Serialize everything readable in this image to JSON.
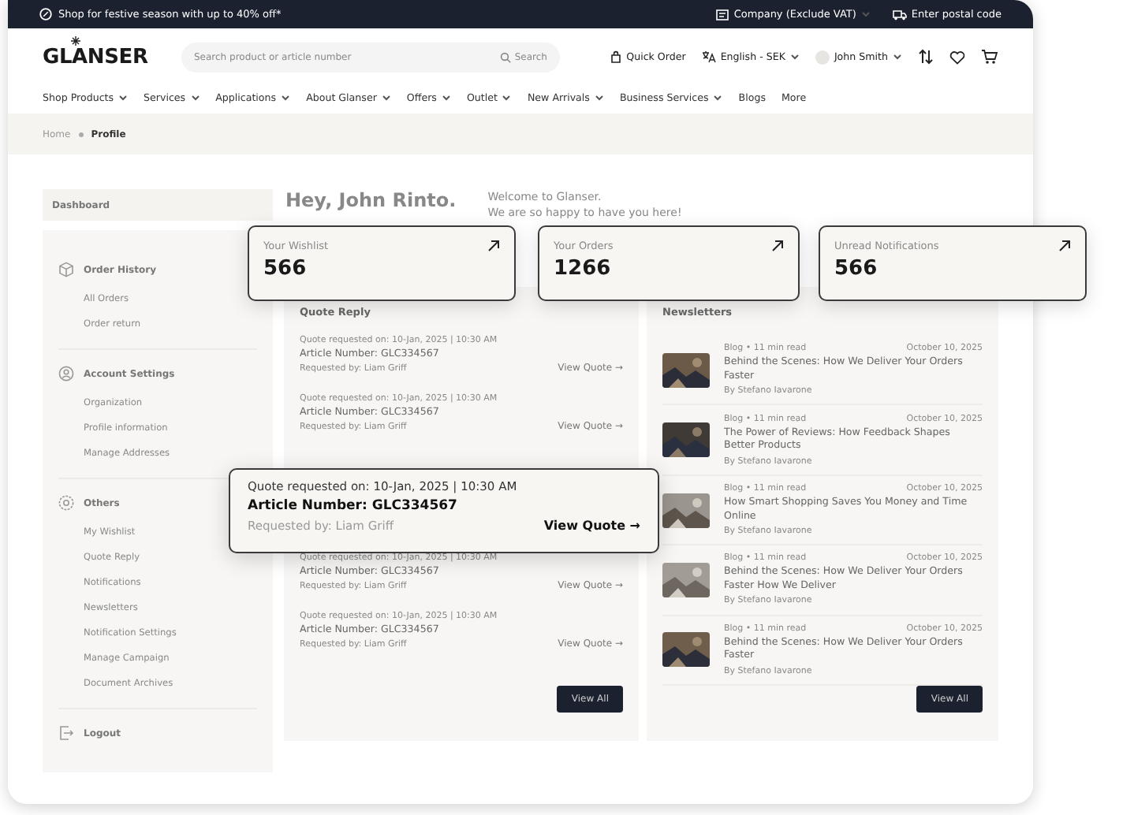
{
  "promo_bar": {
    "message": "Shop for festive season with up to 40% off*",
    "account_type": "Company (Exclude VAT)",
    "postal_code": "Enter postal code"
  },
  "header": {
    "logo": "GLANSER",
    "search": {
      "placeholder": "Search product or article number",
      "button": "Search"
    },
    "quick_order": "Quick Order",
    "language": "English - SEK",
    "user": "John Smith"
  },
  "nav": [
    {
      "label": "Shop Products",
      "has_menu": true
    },
    {
      "label": "Services",
      "has_menu": true
    },
    {
      "label": "Applications",
      "has_menu": true
    },
    {
      "label": "About Glanser",
      "has_menu": true
    },
    {
      "label": "Offers",
      "has_menu": true
    },
    {
      "label": "Outlet",
      "has_menu": true
    },
    {
      "label": "New Arrivals",
      "has_menu": true
    },
    {
      "label": "Business Services",
      "has_menu": true
    },
    {
      "label": "Blogs",
      "has_menu": false
    },
    {
      "label": "More",
      "has_menu": false
    }
  ],
  "breadcrumb": [
    {
      "label": "Home",
      "current": false
    },
    {
      "label": "Profile",
      "current": true
    }
  ],
  "sidebar": {
    "heading": "Dashboard",
    "sections": [
      {
        "title": "Order History",
        "items": [
          "All Orders",
          "Order return"
        ]
      },
      {
        "title": "Account Settings",
        "items": [
          "Organization",
          "Profile information",
          "Manage Addresses"
        ]
      },
      {
        "title": "Others",
        "items": [
          "My Wishlist",
          "Quote Reply",
          "Notifications",
          "Newsletters",
          "Notification Settings",
          "Manage Campaign",
          "Document Archives"
        ]
      }
    ],
    "logout": "Logout"
  },
  "greeting": {
    "title": "Hey, John Rinto.",
    "lines": [
      "Welcome to Glanser.",
      "We are so happy to have you here!"
    ]
  },
  "stat_cards": [
    {
      "label": "Your Wishlist",
      "value": "566"
    },
    {
      "label": "Your Orders",
      "value": "1266"
    },
    {
      "label": "Unread Notifications",
      "value": "566"
    }
  ],
  "quote_reply": {
    "title": "Quote Reply",
    "items": [
      {
        "requested_label": "Quote requested on:",
        "date": "10-Jan, 2025 | 10:30 AM",
        "article": "Article Number: GLC334567",
        "requested_by": "Requested by: Liam Griff",
        "action": "View Quote →"
      },
      {
        "requested_label": "Quote requested on:",
        "date": "10-Jan, 2025 | 10:30 AM",
        "article": "Article Number: GLC334567",
        "requested_by": "Requested by: Liam Griff",
        "action": "View Quote →"
      },
      {
        "requested_label": "Quote requested on:",
        "date": "10-Jan, 2025 | 10:30 AM",
        "article": "Article Number: GLC334567",
        "requested_by": "Requested by: Liam Griff",
        "action": "View Quote →"
      },
      {
        "requested_label": "Quote requested on:",
        "date": "10-Jan, 2025 | 10:30 AM",
        "article": "Article Number: GLC334567",
        "requested_by": "Requested by: Liam Griff",
        "action": "View Quote →"
      }
    ],
    "button": "View All"
  },
  "quote_popup": {
    "requested_label": "Quote requested on:",
    "date": "10-Jan, 2025 | 10:30 AM",
    "article": "Article Number: GLC334567",
    "requested_by": "Requested by: Liam Griff",
    "action": "View Quote →"
  },
  "newsletters": {
    "title": "Newsletters",
    "items": [
      {
        "meta": "Blog • 11 min read",
        "date": "October 10, 2025",
        "title": "Behind the Scenes: How We Deliver Your Orders Faster",
        "author": "By Stefano Iavarone"
      },
      {
        "meta": "Blog • 11 min read",
        "date": "October 10, 2025",
        "title": "The Power of Reviews: How Feedback Shapes Better Products",
        "author": "By Stefano Iavarone"
      },
      {
        "meta": "Blog • 11 min read",
        "date": "October 10, 2025",
        "title": "How Smart Shopping Saves You Money and Time Online",
        "author": "By Stefano Iavarone"
      },
      {
        "meta": "Blog • 11 min read",
        "date": "October 10, 2025",
        "title": "Behind the Scenes: How We Deliver Your Orders Faster  How We Deliver",
        "author": "By Stefano Iavarone"
      },
      {
        "meta": "Blog • 11 min read",
        "date": "October 10, 2025",
        "title": "Behind the Scenes: How We Deliver Your Orders Faster",
        "author": "By Stefano Iavarone"
      }
    ],
    "button": "View All"
  }
}
